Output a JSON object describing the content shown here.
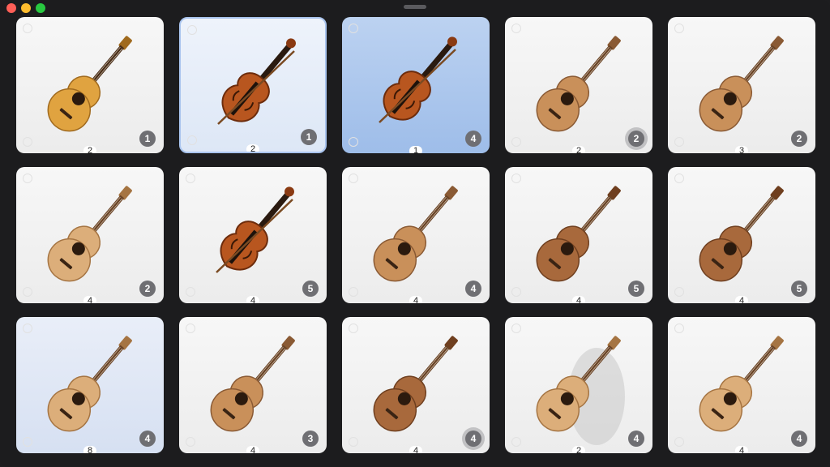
{
  "window": {
    "colors": {
      "close": "#ff5f57",
      "minimize": "#febc2e",
      "zoom": "#28c840"
    }
  },
  "cards": [
    {
      "instrument": "acoustic-guitar",
      "count": "1",
      "caption": "2",
      "style": "default"
    },
    {
      "instrument": "violin",
      "count": "1",
      "caption": "2",
      "style": "light-blue"
    },
    {
      "instrument": "violin",
      "count": "4",
      "caption": "1",
      "style": "blue"
    },
    {
      "instrument": "ukulele",
      "count": "2",
      "caption": "2",
      "style": "default",
      "ring": true
    },
    {
      "instrument": "ukulele",
      "count": "2",
      "caption": "3",
      "style": "default"
    },
    {
      "instrument": "ukulele-light",
      "count": "2",
      "caption": "4",
      "style": "default"
    },
    {
      "instrument": "violin",
      "count": "5",
      "caption": "4",
      "style": "default"
    },
    {
      "instrument": "ukulele",
      "count": "4",
      "caption": "4",
      "style": "default"
    },
    {
      "instrument": "ukulele-dark",
      "count": "5",
      "caption": "4",
      "style": "default"
    },
    {
      "instrument": "ukulele-dark",
      "count": "5",
      "caption": "4",
      "style": "default"
    },
    {
      "instrument": "ukulele-light",
      "count": "4",
      "caption": "8",
      "style": "pale"
    },
    {
      "instrument": "ukulele",
      "count": "3",
      "caption": "4",
      "style": "default"
    },
    {
      "instrument": "ukulele-dark",
      "count": "4",
      "caption": "4",
      "style": "default",
      "ring": true
    },
    {
      "instrument": "ukulele-light",
      "count": "4",
      "caption": "2",
      "style": "default",
      "halo": true
    },
    {
      "instrument": "ukulele-light",
      "count": "4",
      "caption": "4",
      "style": "default"
    }
  ]
}
